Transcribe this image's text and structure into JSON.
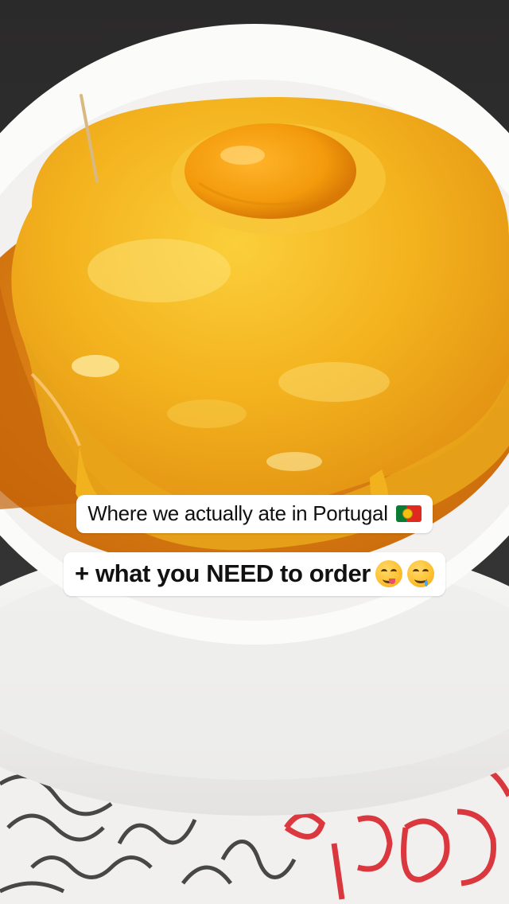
{
  "captions": {
    "line1": "Where we actually ate in Portugal",
    "line2": "+ what you NEED to order"
  },
  "icons": {
    "line1": [
      "portugal-flag-emoji"
    ],
    "line2": [
      "yum-face-emoji",
      "drooling-face-emoji"
    ]
  },
  "colors": {
    "sauce": "#e58a16",
    "cheese": "#f5b722",
    "yolk": "#f39a0c",
    "plate": "#ffffff",
    "caption_bg": "#ffffff",
    "caption_text": "#111111"
  }
}
